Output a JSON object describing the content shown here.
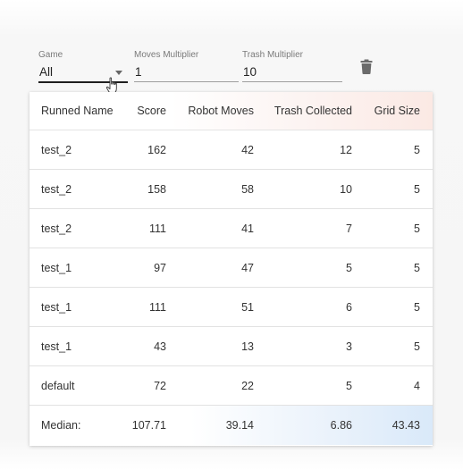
{
  "filters": {
    "game": {
      "label": "Game",
      "value": "All"
    },
    "moves_multiplier": {
      "label": "Moves Multiplier",
      "value": "1"
    },
    "trash_multiplier": {
      "label": "Trash Multiplier",
      "value": "10"
    }
  },
  "icons": {
    "delete": "trash-icon",
    "dropdown": "chevron-down-icon",
    "cursor": "hand-pointer-icon"
  },
  "colors": {
    "header_gradient_end": "#fbe9e4",
    "median_gradient_end": "#d9e9f9"
  },
  "table": {
    "columns": [
      "Runned Name",
      "Score",
      "Robot Moves",
      "Trash Collected",
      "Grid Size"
    ],
    "rows": [
      [
        "test_2",
        "162",
        "42",
        "12",
        "5"
      ],
      [
        "test_2",
        "158",
        "58",
        "10",
        "5"
      ],
      [
        "test_2",
        "111",
        "41",
        "7",
        "5"
      ],
      [
        "test_1",
        "97",
        "47",
        "5",
        "5"
      ],
      [
        "test_1",
        "111",
        "51",
        "6",
        "5"
      ],
      [
        "test_1",
        "43",
        "13",
        "3",
        "5"
      ],
      [
        "default",
        "72",
        "22",
        "5",
        "4"
      ]
    ],
    "median": [
      "Median:",
      "107.71",
      "39.14",
      "6.86",
      "43.43"
    ]
  }
}
